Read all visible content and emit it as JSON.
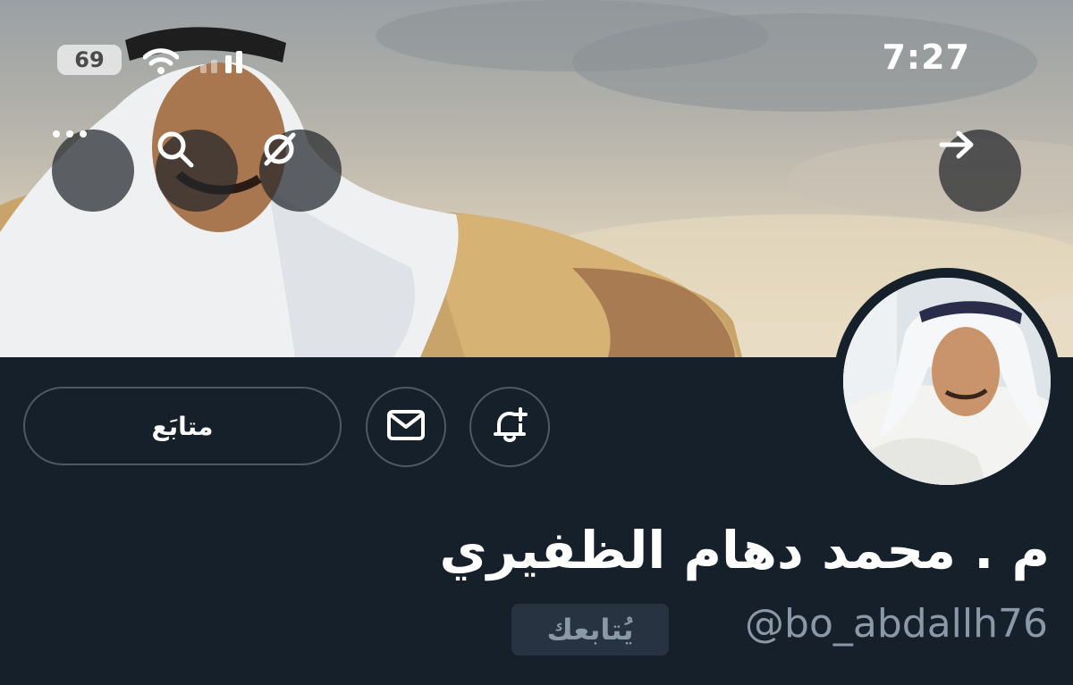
{
  "status_bar": {
    "time": "7:27",
    "battery": "69"
  },
  "header_buttons": {
    "more_icon": "more-horizontal-icon",
    "search_icon": "search-icon",
    "grok_icon": "grok-icon",
    "forward_icon": "arrow-right-icon"
  },
  "actions": {
    "following_label": "متابَع",
    "message_icon": "envelope-icon",
    "notify_icon": "bell-plus-icon"
  },
  "profile": {
    "display_name": "م . محمد دهام الظفيري",
    "handle": "@bo_abdallh76",
    "follows_you_label": "يُتابعك"
  },
  "colors": {
    "background": "#15202b",
    "text_primary": "#ffffff",
    "text_secondary": "#8b98a5",
    "border": "#4d5a66",
    "badge_bg": "#273340"
  }
}
